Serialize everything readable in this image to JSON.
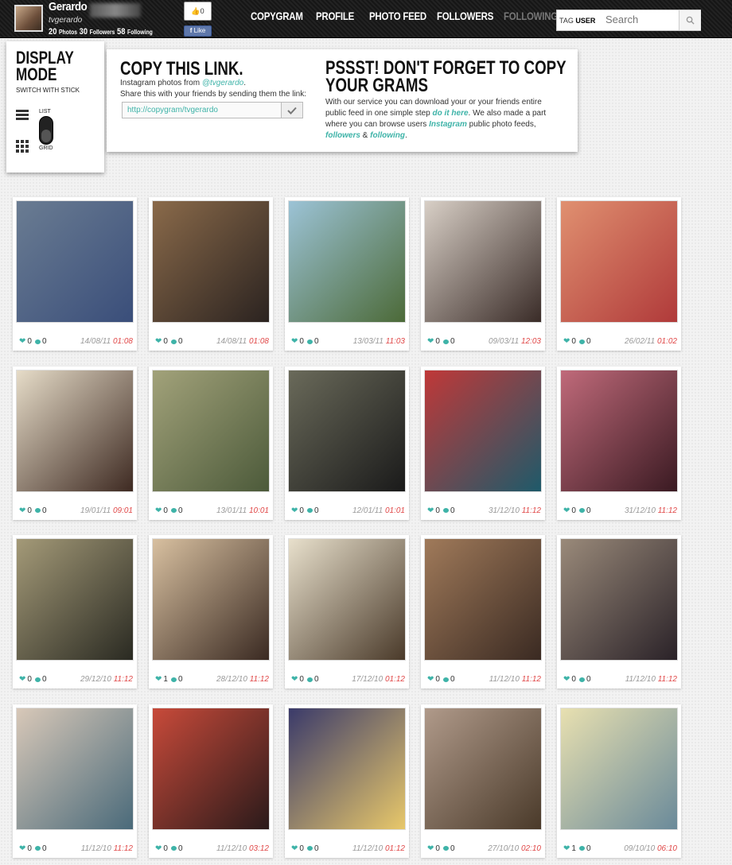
{
  "user": {
    "name": "Gerardo",
    "handle": "tvgerardo",
    "photos_count": "20",
    "photos_label": "Photos",
    "followers_count": "30",
    "followers_label": "Followers",
    "following_count": "58",
    "following_label": "Following"
  },
  "like": {
    "count": "0",
    "label": "Like"
  },
  "nav": [
    "COPYGRAM",
    "PROFILE",
    "PHOTO FEED",
    "FOLLOWERS",
    "FOLLOWING"
  ],
  "search": {
    "toggle_left": "TAG",
    "toggle_right": "USER",
    "placeholder": "Search"
  },
  "display_mode": {
    "title": "DISPLAY MODE",
    "subtitle": "SWITCH WITH STICK",
    "list_label": "LIST",
    "grid_label": "GRID"
  },
  "copy": {
    "title": "COPY THIS LINK.",
    "line1_prefix": "Instagram photos from ",
    "line1_user": "@tvgerardo",
    "line1_suffix": ".",
    "line2": "Share this with your friends by sending them the link:",
    "link": "http://copygram/tvgerardo"
  },
  "psst": {
    "title": "PSSST! DON'T FORGET TO COPY YOUR GRAMS",
    "t1": "With our service you can download your or your friends entire public feed in one simple step ",
    "l1": "do it here",
    "t2": ". We also made a part where you can browse users ",
    "l2": "Instagram",
    "t3": " public photo feeds, ",
    "l3": "followers",
    "t4": " & ",
    "l4": "following",
    "t5": "."
  },
  "photos": [
    {
      "likes": "0",
      "comments": "0",
      "date": "14/08/11",
      "time": "01:08",
      "c1": "#6a7c92",
      "c2": "#3a4e7a"
    },
    {
      "likes": "0",
      "comments": "0",
      "date": "14/08/11",
      "time": "01:08",
      "c1": "#8a6a4a",
      "c2": "#2b2320"
    },
    {
      "likes": "0",
      "comments": "0",
      "date": "13/03/11",
      "time": "11:03",
      "c1": "#9cc3d6",
      "c2": "#4c6a38"
    },
    {
      "likes": "0",
      "comments": "0",
      "date": "09/03/11",
      "time": "12:03",
      "c1": "#d8cfc6",
      "c2": "#3a2c28"
    },
    {
      "likes": "0",
      "comments": "0",
      "date": "26/02/11",
      "time": "01:02",
      "c1": "#e09070",
      "c2": "#b03a3a"
    },
    {
      "likes": "0",
      "comments": "0",
      "date": "19/01/11",
      "time": "09:01",
      "c1": "#e6dcc8",
      "c2": "#3e2a22"
    },
    {
      "likes": "0",
      "comments": "0",
      "date": "13/01/11",
      "time": "10:01",
      "c1": "#a2a27a",
      "c2": "#4c5a3a"
    },
    {
      "likes": "0",
      "comments": "0",
      "date": "12/01/11",
      "time": "01:01",
      "c1": "#6a6a5a",
      "c2": "#1a1a1a"
    },
    {
      "likes": "0",
      "comments": "0",
      "date": "31/12/10",
      "time": "11:12",
      "c1": "#c03838",
      "c2": "#1e5a6a"
    },
    {
      "likes": "0",
      "comments": "0",
      "date": "31/12/10",
      "time": "11:12",
      "c1": "#c06a7a",
      "c2": "#3a1a22"
    },
    {
      "likes": "0",
      "comments": "0",
      "date": "29/12/10",
      "time": "11:12",
      "c1": "#a49a78",
      "c2": "#2a2a22"
    },
    {
      "likes": "1",
      "comments": "0",
      "date": "28/12/10",
      "time": "11:12",
      "c1": "#d8c0a0",
      "c2": "#3a2a22"
    },
    {
      "likes": "0",
      "comments": "0",
      "date": "17/12/10",
      "time": "01:12",
      "c1": "#e8e0cc",
      "c2": "#4a3a2a"
    },
    {
      "likes": "0",
      "comments": "0",
      "date": "11/12/10",
      "time": "11:12",
      "c1": "#a07a5a",
      "c2": "#3a2a22"
    },
    {
      "likes": "0",
      "comments": "0",
      "date": "11/12/10",
      "time": "11:12",
      "c1": "#9a8a7a",
      "c2": "#2a2228"
    },
    {
      "likes": "0",
      "comments": "0",
      "date": "11/12/10",
      "time": "11:12",
      "c1": "#d8c8b8",
      "c2": "#4a6a7a"
    },
    {
      "likes": "0",
      "comments": "0",
      "date": "11/12/10",
      "time": "03:12",
      "c1": "#c84a3a",
      "c2": "#2a1a1a"
    },
    {
      "likes": "0",
      "comments": "0",
      "date": "11/12/10",
      "time": "01:12",
      "c1": "#3a3a6a",
      "c2": "#e8c86a"
    },
    {
      "likes": "0",
      "comments": "0",
      "date": "27/10/10",
      "time": "02:10",
      "c1": "#b09a8a",
      "c2": "#4a3a2a"
    },
    {
      "likes": "1",
      "comments": "0",
      "date": "09/10/10",
      "time": "06:10",
      "c1": "#e8e0b0",
      "c2": "#6a8a9a"
    }
  ]
}
